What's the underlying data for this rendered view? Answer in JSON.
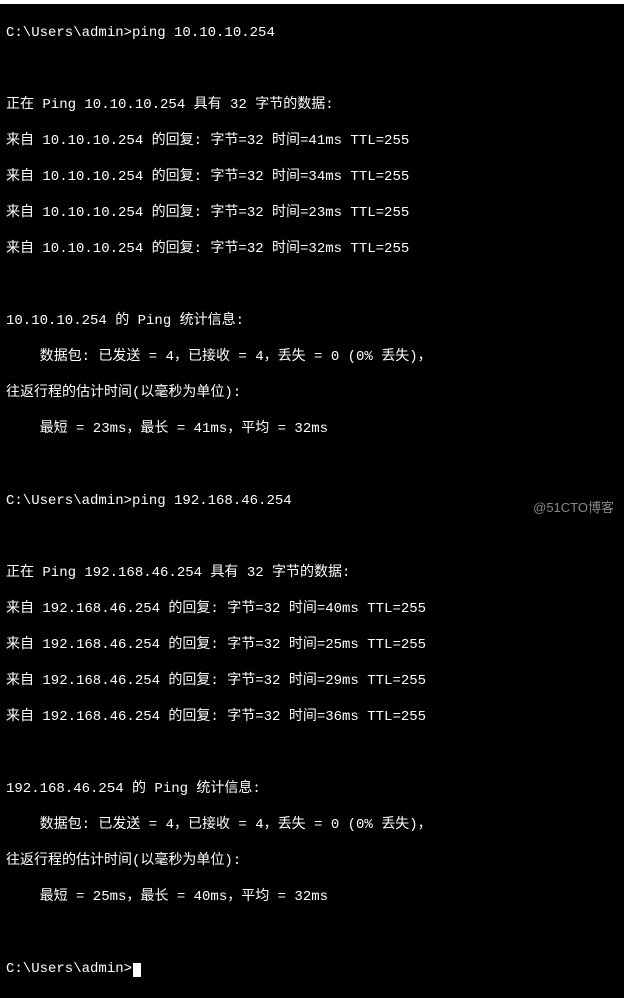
{
  "prompt1": "C:\\Users\\admin>ping 10.10.10.254",
  "ping1_header": "正在 Ping 10.10.10.254 具有 32 字节的数据:",
  "ping1_reply1": "来自 10.10.10.254 的回复: 字节=32 时间=41ms TTL=255",
  "ping1_reply2": "来自 10.10.10.254 的回复: 字节=32 时间=34ms TTL=255",
  "ping1_reply3": "来自 10.10.10.254 的回复: 字节=32 时间=23ms TTL=255",
  "ping1_reply4": "来自 10.10.10.254 的回复: 字节=32 时间=32ms TTL=255",
  "ping1_stats_header": "10.10.10.254 的 Ping 统计信息:",
  "ping1_stats_packets": "    数据包: 已发送 = 4，已接收 = 4，丢失 = 0 (0% 丢失)，",
  "ping1_rtt_header": "往返行程的估计时间(以毫秒为单位):",
  "ping1_rtt_values": "    最短 = 23ms，最长 = 41ms，平均 = 32ms",
  "prompt2": "C:\\Users\\admin>ping 192.168.46.254",
  "ping2_header": "正在 Ping 192.168.46.254 具有 32 字节的数据:",
  "ping2_reply1": "来自 192.168.46.254 的回复: 字节=32 时间=40ms TTL=255",
  "ping2_reply2": "来自 192.168.46.254 的回复: 字节=32 时间=25ms TTL=255",
  "ping2_reply3": "来自 192.168.46.254 的回复: 字节=32 时间=29ms TTL=255",
  "ping2_reply4": "来自 192.168.46.254 的回复: 字节=32 时间=36ms TTL=255",
  "ping2_stats_header": "192.168.46.254 的 Ping 统计信息:",
  "ping2_stats_packets": "    数据包: 已发送 = 4，已接收 = 4，丢失 = 0 (0% 丢失)，",
  "ping2_rtt_header": "往返行程的估计时间(以毫秒为单位):",
  "ping2_rtt_values": "    最短 = 25ms，最长 = 40ms，平均 = 32ms",
  "prompt3": "C:\\Users\\admin>",
  "watermark": "@51CTO博客"
}
